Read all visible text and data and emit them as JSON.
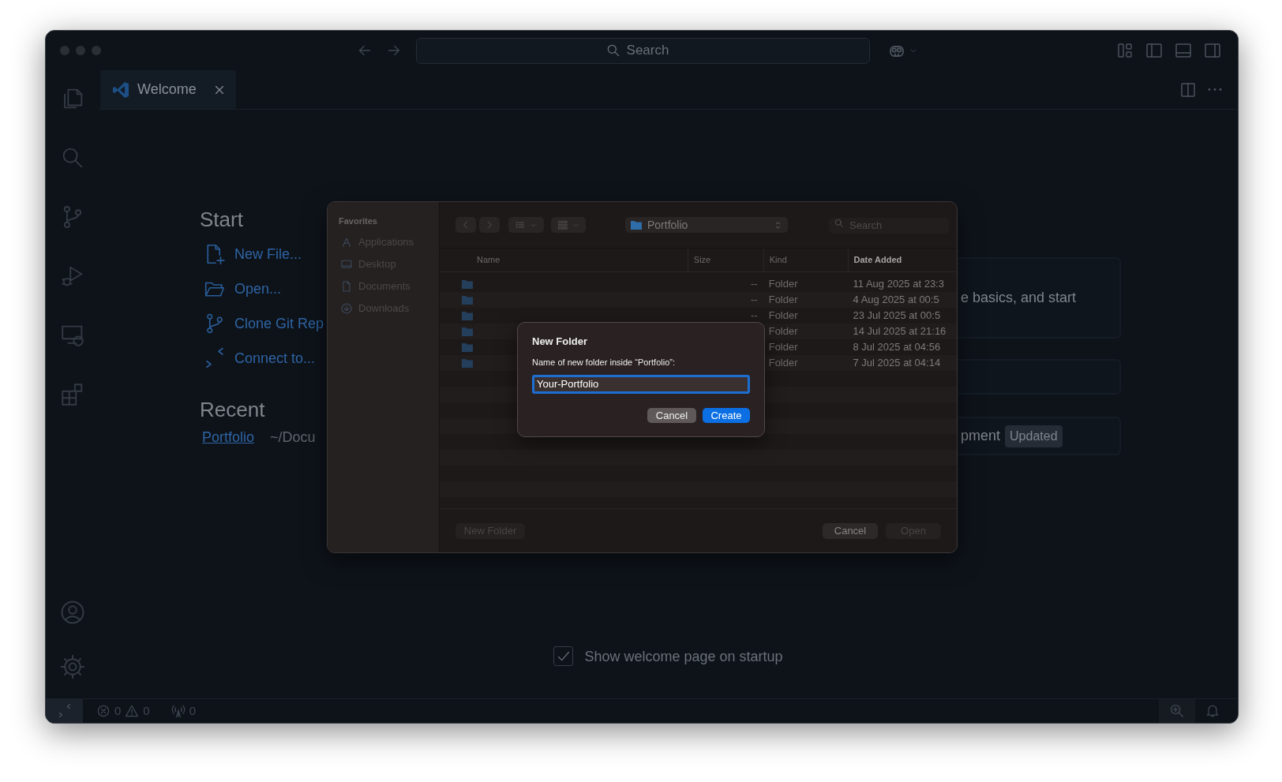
{
  "title_bar": {
    "search": {
      "placeholder": "Search"
    }
  },
  "tabs": [
    {
      "label": "Welcome",
      "selected": true
    }
  ],
  "welcome": {
    "start": {
      "heading": "Start",
      "actions": [
        {
          "label": "New File...",
          "kind": "new-file"
        },
        {
          "label": "Open...",
          "kind": "open"
        },
        {
          "label": "Clone Git Rep",
          "kind": "clone"
        },
        {
          "label": "Connect to...",
          "kind": "connect"
        }
      ]
    },
    "recent": {
      "heading": "Recent",
      "items": [
        {
          "name": "Portfolio",
          "path": "~/Docu"
        }
      ]
    },
    "cards": [
      {
        "kind": "text",
        "text": "e basics, and start"
      },
      {
        "kind": "blank"
      },
      {
        "kind": "text",
        "text": "pment",
        "badge": "Updated"
      }
    ],
    "show_on_startup": {
      "label": "Show welcome page on startup",
      "checked": true
    }
  },
  "file_dialog": {
    "sidebar": {
      "heading": "Favorites",
      "items": [
        {
          "label": "Applications",
          "kind": "applications"
        },
        {
          "label": "Desktop",
          "kind": "desktop"
        },
        {
          "label": "Documents",
          "kind": "documents"
        },
        {
          "label": "Downloads",
          "kind": "downloads"
        }
      ]
    },
    "toolbar": {
      "location": "Portfolio",
      "search": {
        "placeholder": "Search"
      }
    },
    "columns": [
      {
        "label": "Name",
        "sorted": false
      },
      {
        "label": "Size",
        "sorted": false
      },
      {
        "label": "Kind",
        "sorted": false
      },
      {
        "label": "Date Added",
        "sorted": true
      }
    ],
    "rows": [
      {
        "size": "--",
        "kind": "Folder",
        "date_added": "11 Aug 2025 at 23:3"
      },
      {
        "size": "--",
        "kind": "Folder",
        "date_added": "4 Aug 2025 at 00:5"
      },
      {
        "size": "--",
        "kind": "Folder",
        "date_added": "23 Jul 2025 at 00:5"
      },
      {
        "kind": "Folder",
        "date_added": "14 Jul 2025 at 21:16"
      },
      {
        "kind": "Folder",
        "date_added": "8 Jul 2025 at 04:56"
      },
      {
        "kind": "Folder",
        "date_added": "7 Jul 2025 at 04:14"
      }
    ],
    "buttons": [
      {
        "label": "New Folder",
        "disabled": true,
        "kind": "left"
      },
      {
        "label": "Cancel",
        "disabled": false,
        "kind": "right"
      },
      {
        "label": "Open",
        "disabled": true,
        "kind": "right"
      }
    ]
  },
  "new_folder_sheet": {
    "title": "New Folder",
    "prompt": "Name of new folder inside “Portfolio”:",
    "value": "Your-Portfolio",
    "buttons": [
      {
        "label": "Cancel",
        "default": false
      },
      {
        "label": "Create",
        "default": true
      }
    ]
  },
  "status_bar": {
    "errors": "0",
    "warnings": "0",
    "ports": "0"
  }
}
